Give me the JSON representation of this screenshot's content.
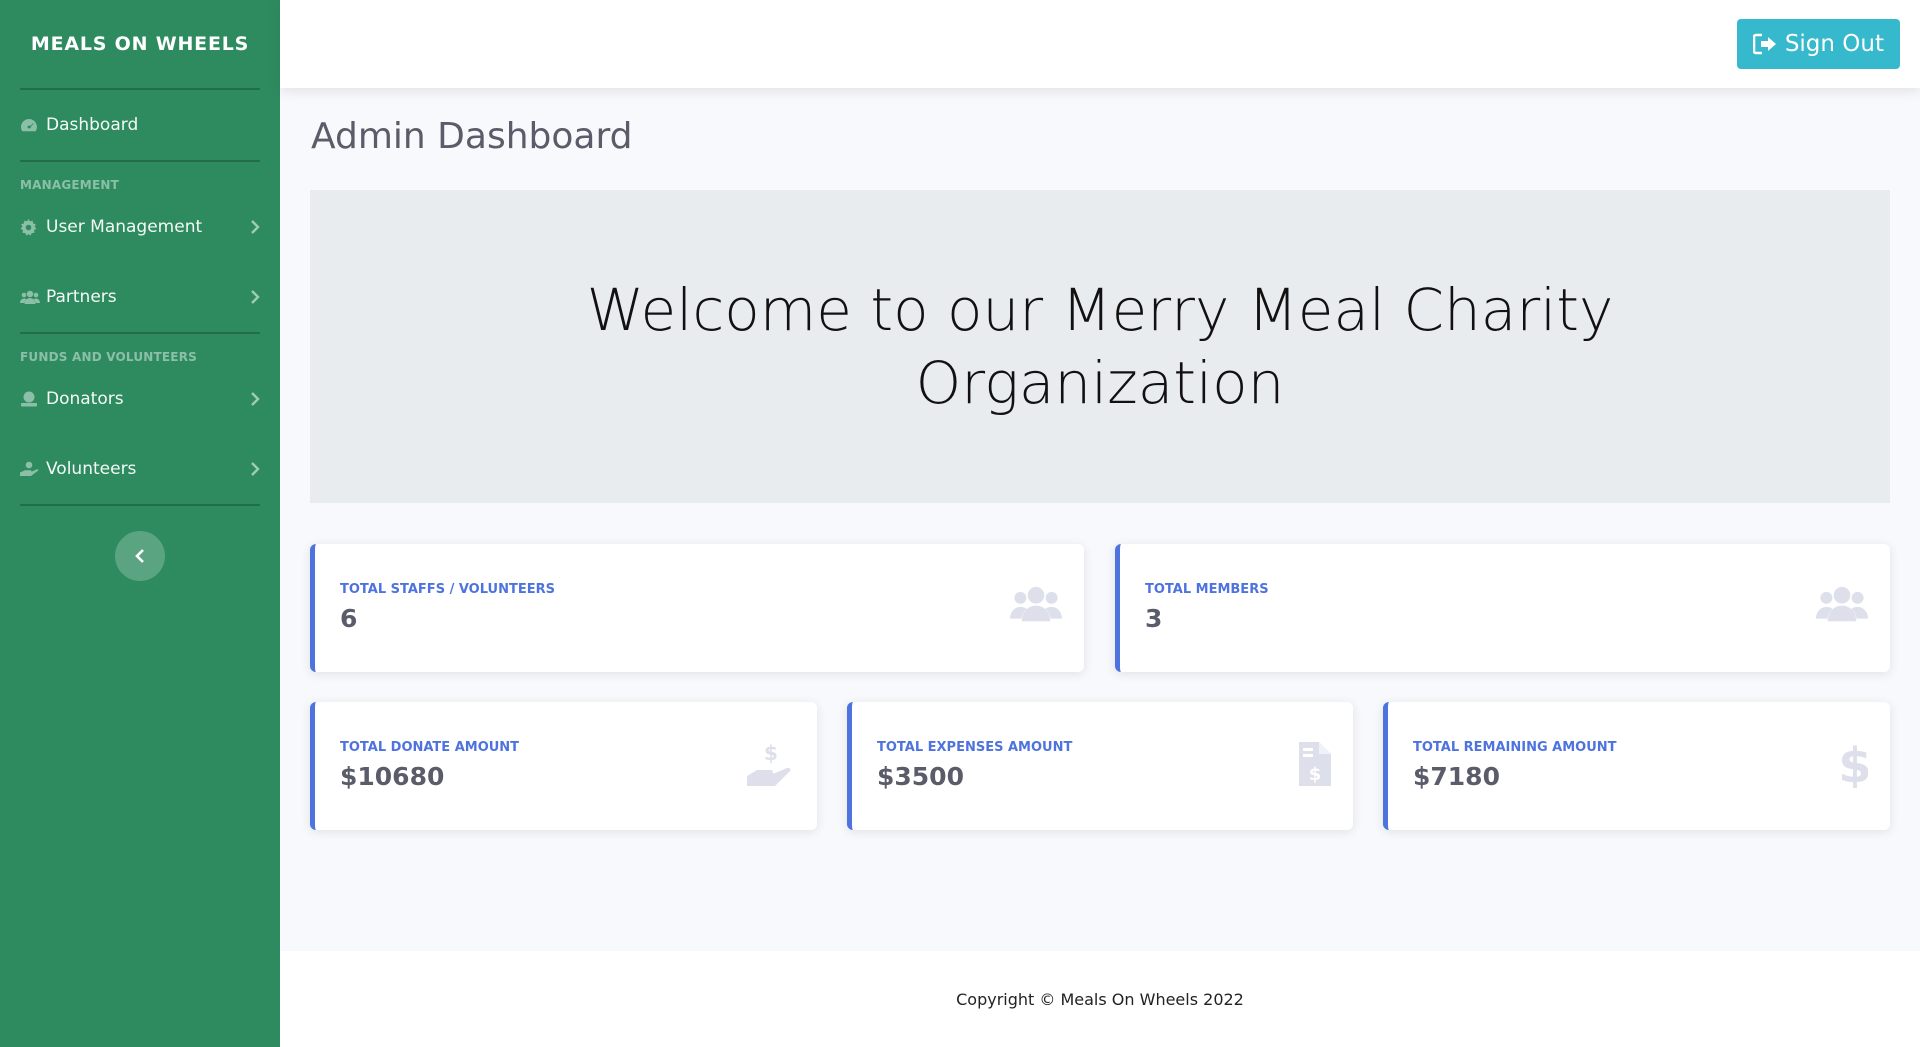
{
  "sidebar": {
    "brand": "MEALS ON WHEELS",
    "dashboard": "Dashboard",
    "section_management": "MANAGEMENT",
    "user_management": "User Management",
    "partners": "Partners",
    "section_funds": "FUNDS AND VOLUNTEERS",
    "donators": "Donators",
    "volunteers": "Volunteers"
  },
  "topbar": {
    "signout": "Sign Out"
  },
  "main": {
    "title": "Admin Dashboard",
    "welcome": "Welcome to our Merry Meal Charity Organization"
  },
  "stats": [
    {
      "label": "TOTAL STAFFS / VOLUNTEERS",
      "value": "6",
      "icon": "users-icon"
    },
    {
      "label": "TOTAL MEMBERS",
      "value": "3",
      "icon": "users-icon"
    },
    {
      "label": "TOTAL DONATE AMOUNT",
      "value": "$10680",
      "icon": "hand-dollar-icon"
    },
    {
      "label": "TOTAL EXPENSES AMOUNT",
      "value": "$3500",
      "icon": "invoice-dollar-icon"
    },
    {
      "label": "TOTAL REMAINING AMOUNT",
      "value": "$7180",
      "icon": "dollar-icon"
    }
  ],
  "footer": {
    "copyright": "Copyright © Meals On Wheels 2022"
  },
  "colors": {
    "sidebar": "#2e8b5f",
    "primary": "#4e73df",
    "signout": "#36b9cc"
  }
}
